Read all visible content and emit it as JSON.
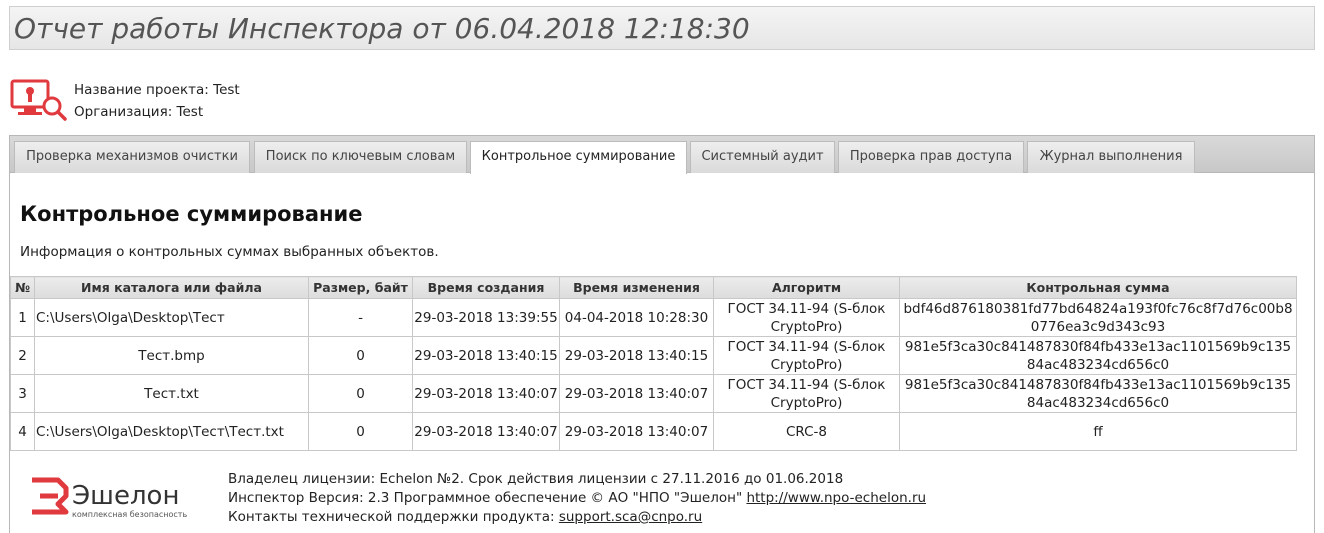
{
  "header": {
    "title": "Отчет работы Инспектора от 06.04.2018 12:18:30"
  },
  "project": {
    "name_line": "Название проекта: Test",
    "org_line": "Организация: Test",
    "logo_icon": "inspector-monitor-icon"
  },
  "tabs": [
    {
      "label": "Проверка механизмов очистки"
    },
    {
      "label": "Поиск по ключевым словам"
    },
    {
      "label": "Контрольное суммирование"
    },
    {
      "label": "Системный аудит"
    },
    {
      "label": "Проверка прав доступа"
    },
    {
      "label": "Журнал выполнения"
    }
  ],
  "active_tab": "Контрольное суммирование",
  "section": {
    "title": "Контрольное суммирование",
    "description": "Информация о контрольных суммах выбранных объектов."
  },
  "table": {
    "headers": [
      "№",
      "Имя каталога или файла",
      "Размер, байт",
      "Время создания",
      "Время изменения",
      "Алгоритм",
      "Контрольная сумма"
    ],
    "rows": [
      [
        "1",
        "C:\\Users\\Olga\\Desktop\\Тест",
        "-",
        "29-03-2018 13:39:55",
        "04-04-2018 10:28:30",
        "ГОСТ 34.11-94 (S-блок CryptoPro)",
        "bdf46d876180381fd77bd64824a193f0fc76c8f7d76c00b80776ea3c9d343c93"
      ],
      [
        "2",
        "Тест.bmp",
        "0",
        "29-03-2018 13:40:15",
        "29-03-2018 13:40:15",
        "ГОСТ 34.11-94 (S-блок CryptoPro)",
        "981e5f3ca30c841487830f84fb433e13ac1101569b9c13584ac483234cd656c0"
      ],
      [
        "3",
        "Тест.txt",
        "0",
        "29-03-2018 13:40:07",
        "29-03-2018 13:40:07",
        "ГОСТ 34.11-94 (S-блок CryptoPro)",
        "981e5f3ca30c841487830f84fb433e13ac1101569b9c13584ac483234cd656c0"
      ],
      [
        "4",
        "C:\\Users\\Olga\\Desktop\\Тест\\Тест.txt",
        "0",
        "29-03-2018 13:40:07",
        "29-03-2018 13:40:07",
        "CRC-8",
        "ff"
      ]
    ]
  },
  "footer": {
    "logo_text": "Эшелон",
    "logo_tagline": "комплексная безопасность",
    "license_line": "Владелец лицензии: Echelon №2. Срок действия лицензии с 27.11.2016 до 01.06.2018",
    "version_prefix": "Инспектор Версия: 2.3 Программное обеспечение © АО \"НПО \"Эшелон\" ",
    "version_link": "http://www.npo-echelon.ru",
    "support_prefix": "Контакты технической поддержки продукта: ",
    "support_link": "support.sca@cnpo.ru"
  },
  "colors": {
    "brand_red": "#e03a3e",
    "tab_bg": "#dadada",
    "border": "#b8b8b8"
  }
}
